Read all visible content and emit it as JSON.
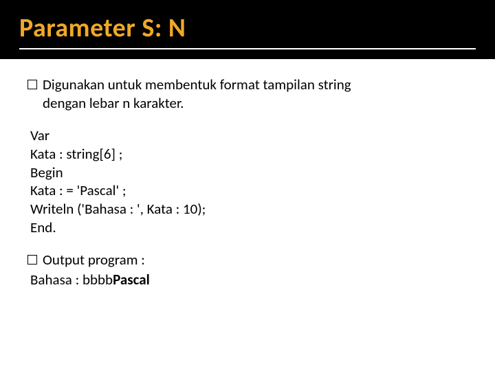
{
  "slide": {
    "title": "Parameter S: N",
    "desc_line1": "Digunakan untuk membentuk format tampilan string",
    "desc_line2": "dengan lebar n karakter.",
    "code": {
      "l1": "Var",
      "l2": " Kata : string[6] ;",
      "l3": "Begin",
      "l4": " Kata : = 'Pascal' ;",
      "l5": " Writeln ('Bahasa : ', Kata : 10);",
      "l6": "End."
    },
    "output_label": "Output program :",
    "output_prefix": "Bahasa : bbbb",
    "output_bold": "Pascal"
  }
}
